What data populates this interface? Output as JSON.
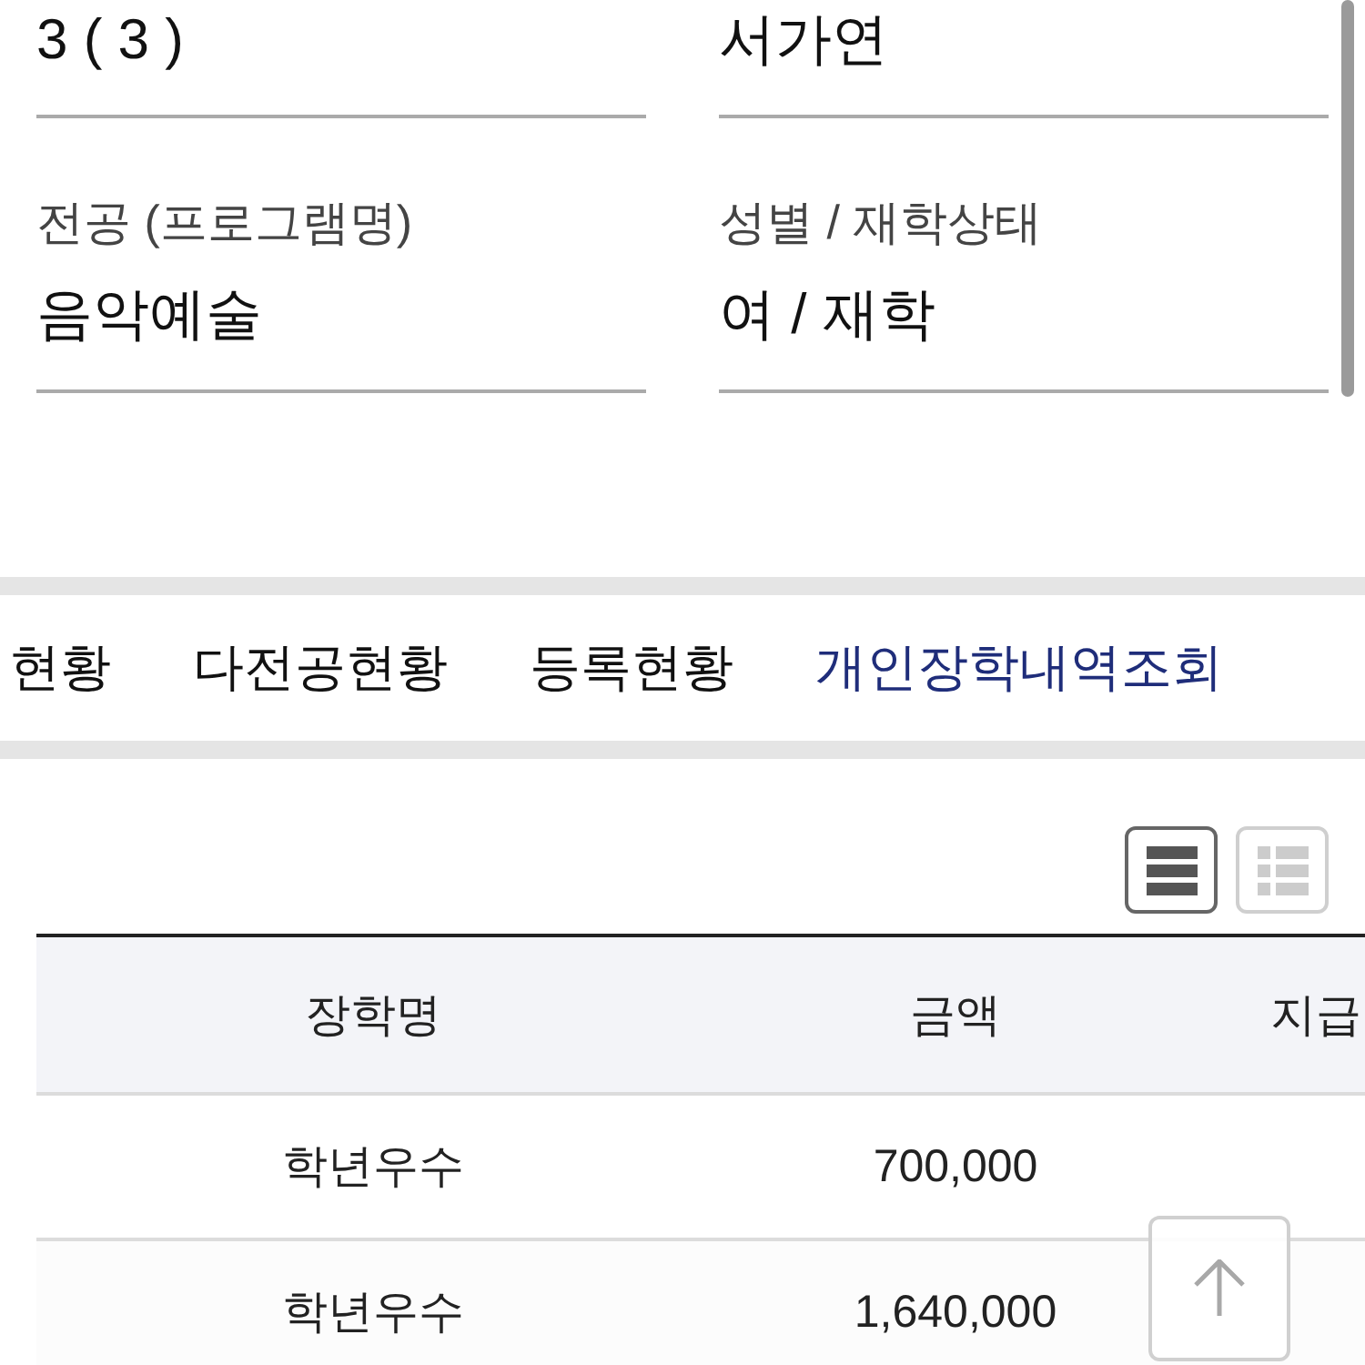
{
  "fields": [
    {
      "value": "3 ( 3 )"
    },
    {
      "value": "서가연"
    },
    {
      "label": "전공 (프로그램명)",
      "value": "음악예술"
    },
    {
      "label": "성별 / 재학상태",
      "value": "여 / 재학"
    }
  ],
  "tabs": [
    {
      "label": "현황",
      "selected": false
    },
    {
      "label": "다전공현황",
      "selected": false
    },
    {
      "label": "등록현황",
      "selected": false
    },
    {
      "label": "개인장학내역조회",
      "selected": true
    }
  ],
  "view_toggle": [
    {
      "kind": "list",
      "selected": true
    },
    {
      "kind": "grid",
      "selected": false
    }
  ],
  "table": {
    "columns": [
      "장학명",
      "금액",
      "지급"
    ],
    "rows": [
      [
        "학년우수",
        "700,000"
      ],
      [
        "학년우수",
        "1,640,000"
      ]
    ]
  }
}
